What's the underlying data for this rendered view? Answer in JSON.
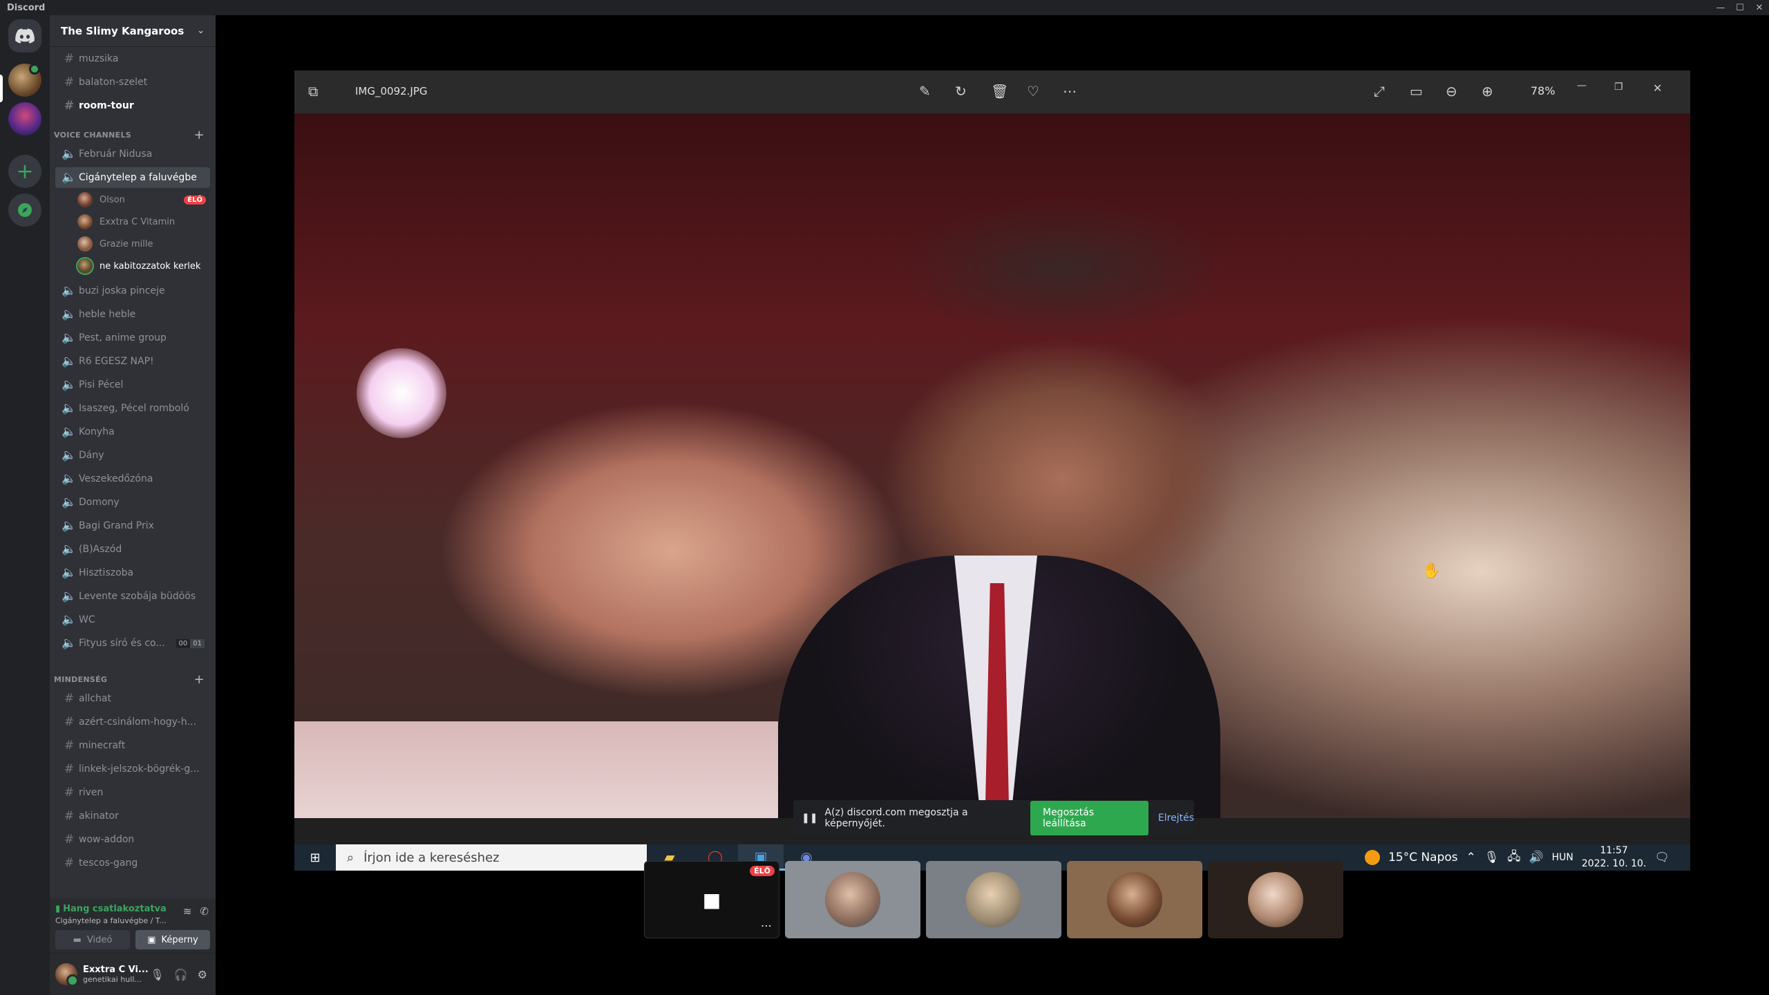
{
  "window": {
    "app_title": "Discord"
  },
  "server": {
    "name": "The Slimy Kangaroos"
  },
  "channels_top": [
    {
      "label": "muzsika",
      "type": "text"
    },
    {
      "label": "balaton-szelet",
      "type": "text"
    },
    {
      "label": "room-tour",
      "type": "text",
      "unread": true
    }
  ],
  "categories": {
    "voice": "VOICE CHANNELS",
    "misc": "MINDENSÉG"
  },
  "voice_channels": [
    {
      "label": "Február Nidusa"
    },
    {
      "label": "Cigánytelep a faluvégbe",
      "active": true
    },
    {
      "label": "buzi joska pinceje"
    },
    {
      "label": "heble heble"
    },
    {
      "label": "Pest, anime group"
    },
    {
      "label": "R6 EGÉSZ NAP!"
    },
    {
      "label": "Pisi Pécel"
    },
    {
      "label": "Isaszeg, Pécel romboló"
    },
    {
      "label": "Konyha"
    },
    {
      "label": "Dány"
    },
    {
      "label": "Veszekedőzóna"
    },
    {
      "label": "Domony"
    },
    {
      "label": "Bagi Grand Prix"
    },
    {
      "label": "(B)Aszód"
    },
    {
      "label": "Hisztiszoba"
    },
    {
      "label": "Levente szobája büdöös"
    },
    {
      "label": "WC"
    },
    {
      "label": "Fityus síró és co...",
      "limit": [
        "00",
        "01"
      ]
    }
  ],
  "voice_users": [
    {
      "name": "Olson",
      "live": "ÉLŐ"
    },
    {
      "name": "Exxtra C Vitamin"
    },
    {
      "name": "Grazie mille"
    },
    {
      "name": "ne kabitozzatok kerlek",
      "bright": true
    }
  ],
  "text_channels": [
    {
      "label": "allchat"
    },
    {
      "label": "azért-csinálom-hogy-h..."
    },
    {
      "label": "minecraft"
    },
    {
      "label": "linkek-jelszok-bögrék-g..."
    },
    {
      "label": "riven"
    },
    {
      "label": "akinator"
    },
    {
      "label": "wow-addon"
    },
    {
      "label": "tescos-gang"
    }
  ],
  "voice_panel": {
    "status": "Hang csatlakoztatva",
    "sub": "Cigánytelep a faluvégbe / T...",
    "video_label": "Videó",
    "screen_label": "Képerny"
  },
  "user": {
    "name": "Exxtra C Vi...",
    "status": "genetikai hull..."
  },
  "viewer": {
    "filename": "IMG_0092.JPG",
    "zoom": "78%",
    "icons": [
      "edit-icon",
      "rotate-icon",
      "delete-icon",
      "heart-icon",
      "more-icon",
      "fullscreen-icon",
      "slideshow-icon",
      "zoom-out-icon",
      "zoom-in-icon"
    ]
  },
  "share_bar": {
    "message": "A(z) discord.com megosztja a képernyőjét.",
    "stop_label": "Megosztás leállítása",
    "hide_label": "Elrejtés"
  },
  "taskbar": {
    "search_placeholder": "Írjon ide a kereséshez",
    "weather": "15°C  Napos",
    "lang": "HUN",
    "time": "11:57",
    "date": "2022. 10. 10."
  },
  "participants": {
    "live_badge": "ÉLŐ"
  },
  "colors": {
    "accent_green": "#3ba55d",
    "live_red": "#ed4245",
    "sidebar_bg": "#2f3136",
    "guild_bg": "#202225"
  }
}
